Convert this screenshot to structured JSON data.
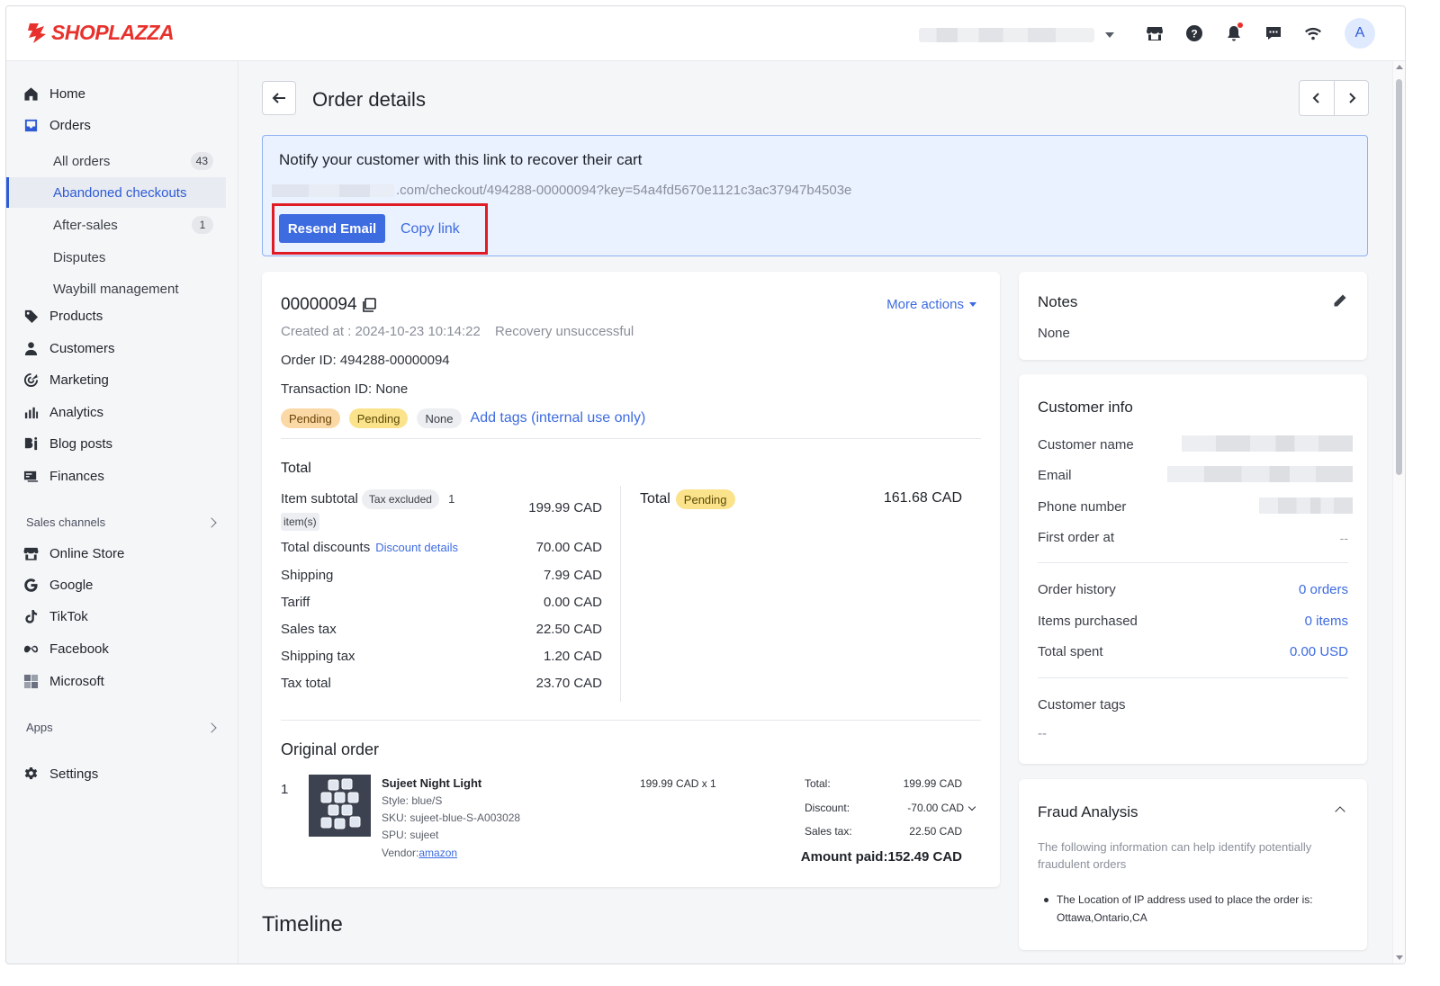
{
  "brand": {
    "name": "SHOPLAZZA",
    "logo_icon": "shoplazza-logo-icon",
    "accent": "#e8312c"
  },
  "topbar": {
    "icons": [
      "store-icon",
      "help-icon",
      "bell-icon",
      "message-icon",
      "wifi-icon"
    ],
    "avatar_initial": "A"
  },
  "sidebar": {
    "home": "Home",
    "orders": "Orders",
    "all_orders": "All orders",
    "all_orders_count": "43",
    "abandoned_checkouts": "Abandoned checkouts",
    "after_sales": "After-sales",
    "after_sales_count": "1",
    "disputes": "Disputes",
    "waybill": "Waybill management",
    "products": "Products",
    "customers": "Customers",
    "marketing": "Marketing",
    "analytics": "Analytics",
    "blog_posts": "Blog posts",
    "finances": "Finances",
    "sales_channels": "Sales channels",
    "online_store": "Online Store",
    "google": "Google",
    "tiktok": "TikTok",
    "facebook": "Facebook",
    "microsoft": "Microsoft",
    "apps": "Apps",
    "settings": "Settings"
  },
  "header": {
    "title": "Order details"
  },
  "notify": {
    "title": "Notify your customer with this link to recover their cart",
    "link": ".com/checkout/494288-00000094?key=54a4fd5670e1121c3ac37947b4503e",
    "resend_label": "Resend Email",
    "copy_label": "Copy link"
  },
  "order": {
    "number": "00000094",
    "more_actions": "More actions",
    "created_at": "Created at :  2024-10-23 10:14:22",
    "recovery_status": "Recovery unsuccessful",
    "order_id": "Order ID: 494288-00000094",
    "transaction_id": "Transaction ID: None",
    "tags": [
      "Pending",
      "Pending",
      "None"
    ],
    "add_tags": "Add tags (internal use only)"
  },
  "totals": {
    "title": "Total",
    "item_subtotal_label": "Item subtotal",
    "tax_excluded": "Tax excluded",
    "item_count": "1",
    "item_unit": "item(s)",
    "item_subtotal": "199.99 CAD",
    "total_discounts_label": "Total discounts",
    "discount_details": "Discount details",
    "total_discounts": "70.00 CAD",
    "shipping_label": "Shipping",
    "shipping": "7.99 CAD",
    "tariff_label": "Tariff",
    "tariff": "0.00 CAD",
    "sales_tax_label": "Sales tax",
    "sales_tax": "22.50 CAD",
    "shipping_tax_label": "Shipping tax",
    "shipping_tax": "1.20 CAD",
    "tax_total_label": "Tax total",
    "tax_total": "23.70 CAD",
    "total_label": "Total",
    "total_status": "Pending",
    "total_value": "161.68 CAD"
  },
  "original_order": {
    "title": "Original order",
    "line_number": "1",
    "product_name": "Sujeet Night Light",
    "style": "Style: blue/S",
    "sku": "SKU: sujeet-blue-S-A003028",
    "spu": "SPU: sujeet",
    "vendor_label": "Vendor:",
    "vendor": "amazon",
    "unit_price": "199.99 CAD x 1",
    "total_label": "Total:",
    "total": "199.99 CAD",
    "discount_label": "Discount:",
    "discount": "-70.00 CAD",
    "sales_tax_label": "Sales tax:",
    "sales_tax": "22.50 CAD",
    "amount_paid": "Amount paid:152.49 CAD"
  },
  "timeline": {
    "title": "Timeline"
  },
  "notes": {
    "title": "Notes",
    "value": "None"
  },
  "customer_info": {
    "title": "Customer info",
    "name_label": "Customer name",
    "email_label": "Email",
    "phone_label": "Phone number",
    "first_order_label": "First order at",
    "first_order": "--",
    "order_history_label": "Order history",
    "order_history": "0 orders",
    "items_purchased_label": "Items purchased",
    "items_purchased": "0 items",
    "total_spent_label": "Total spent",
    "total_spent": "0.00 USD",
    "tags_label": "Customer tags",
    "tags": "--"
  },
  "fraud": {
    "title": "Fraud Analysis",
    "description": "The following information can help identify potentially fraudulent orders",
    "ip_location": "The Location of IP address used to place the order is: Ottawa,Ontario,CA"
  }
}
